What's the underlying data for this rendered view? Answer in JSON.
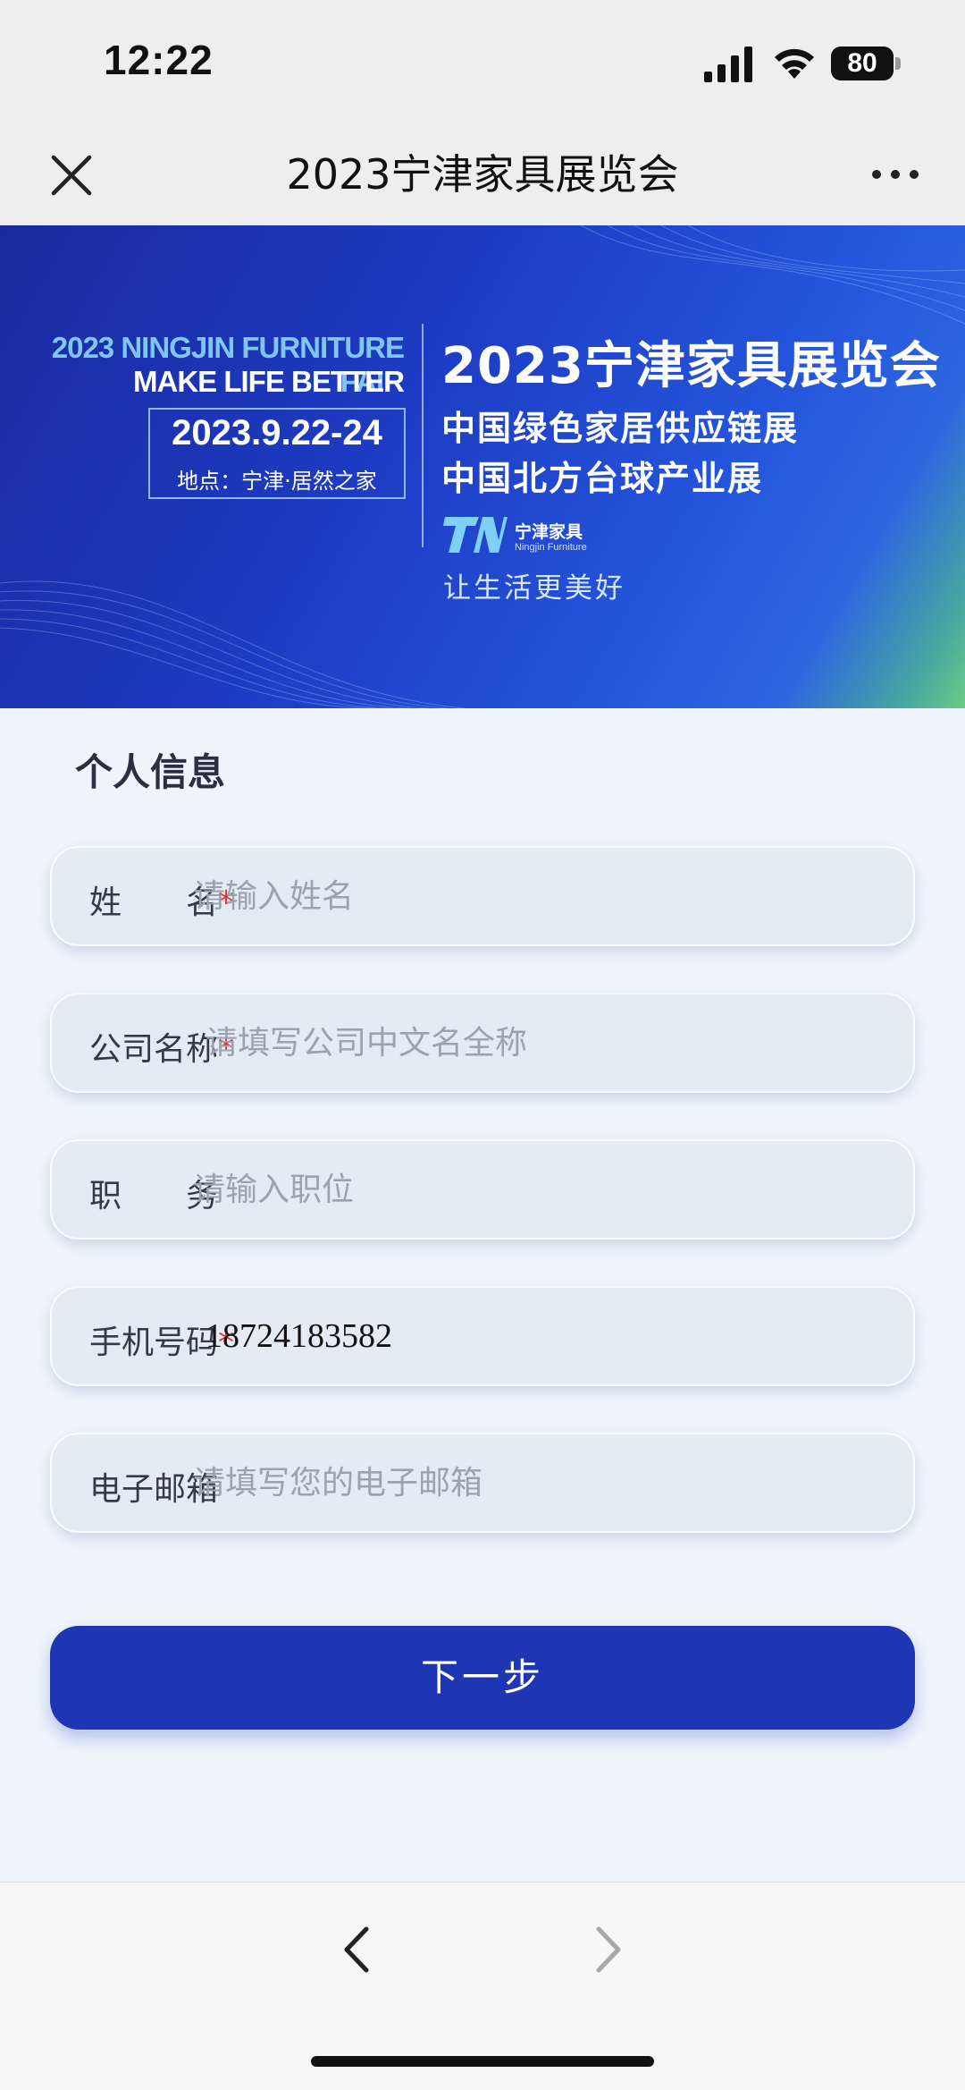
{
  "status_bar": {
    "time": "12:22",
    "battery": "80",
    "icons": [
      "signal-icon",
      "wifi-icon",
      "battery-icon"
    ]
  },
  "nav": {
    "title": "2023宁津家具展览会",
    "close_icon": "close-icon",
    "more_icon": "more-icon"
  },
  "banner": {
    "en_line1": "2023 NINGJIN FURNITURE FAIR",
    "en_line2": "MAKE LIFE BETTER",
    "date": "2023.9.22-24",
    "location": "地点：宁津·居然之家",
    "title": "2023宁津家具展览会",
    "subtitle1": "中国绿色家居供应链展",
    "subtitle2": "中国北方台球产业展",
    "logo_cn": "宁津家具",
    "logo_en": "Ningjin Furniture",
    "slogan": "让生活更美好"
  },
  "form": {
    "section_title": "个人信息",
    "fields": [
      {
        "label": "姓　　名",
        "required": "*",
        "placeholder": "请输入姓名",
        "value": ""
      },
      {
        "label": "公司名称",
        "required": "*",
        "placeholder": "请填写公司中文名全称",
        "value": ""
      },
      {
        "label": "职　　务",
        "required": "",
        "placeholder": "请输入职位",
        "value": ""
      },
      {
        "label": "手机号码",
        "required": "*",
        "placeholder": "",
        "value": "18724183582"
      },
      {
        "label": "电子邮箱",
        "required": "",
        "placeholder": "请填写您的电子邮箱",
        "value": ""
      }
    ],
    "next_label": "下一步"
  },
  "bottom_bar": {
    "back_icon": "chevron-left-icon",
    "forward_icon": "chevron-right-icon"
  },
  "colors": {
    "primary_button": "#1e36b4",
    "required_star": "#e53535",
    "form_background": "#eef5fd"
  }
}
